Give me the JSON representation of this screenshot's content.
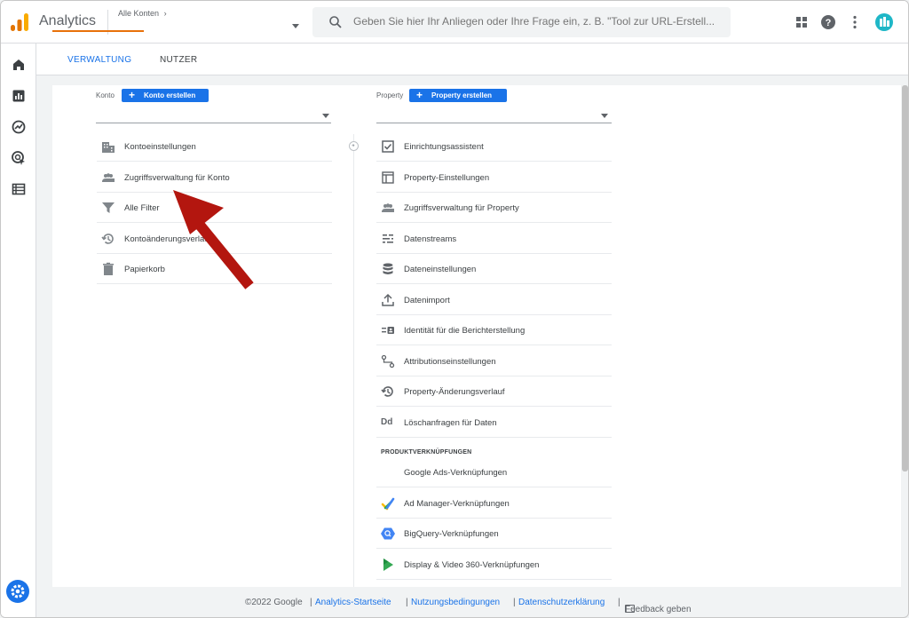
{
  "header": {
    "app_title": "Analytics",
    "account_breadcrumb": "Alle Konten",
    "search_placeholder": "Geben Sie hier Ihr Anliegen oder Ihre Frage ein, z. B. \"Tool zur URL-Erstell...",
    "icons": [
      "apps-icon",
      "help-icon",
      "more-vert-icon",
      "account-avatar-icon"
    ]
  },
  "sidebar": {
    "items": [
      {
        "name": "home-icon"
      },
      {
        "name": "reports-icon"
      },
      {
        "name": "explore-icon"
      },
      {
        "name": "advertising-icon"
      },
      {
        "name": "configure-icon"
      }
    ],
    "settings_icon": "gear-icon"
  },
  "tabs": [
    {
      "label": "VERWALTUNG",
      "active": true
    },
    {
      "label": "NUTZER",
      "active": false
    }
  ],
  "account_column": {
    "label": "Konto",
    "create_label": "Konto erstellen",
    "items": [
      {
        "label": "Kontoeinstellungen",
        "icon": "building-icon"
      },
      {
        "label": "Zugriffsverwaltung für Konto",
        "icon": "people-icon"
      },
      {
        "label": "Alle Filter",
        "icon": "filter-icon"
      },
      {
        "label": "Kontoänderungsverlauf",
        "icon": "history-icon"
      },
      {
        "label": "Papierkorb",
        "icon": "trash-icon"
      }
    ]
  },
  "property_column": {
    "label": "Property",
    "create_label": "Property erstellen",
    "items": [
      {
        "label": "Einrichtungsassistent",
        "icon": "checkbox-icon"
      },
      {
        "label": "Property-Einstellungen",
        "icon": "layout-icon"
      },
      {
        "label": "Zugriffsverwaltung für Property",
        "icon": "people-icon"
      },
      {
        "label": "Datenstreams",
        "icon": "streams-icon"
      },
      {
        "label": "Dateneinstellungen",
        "icon": "database-icon"
      },
      {
        "label": "Datenimport",
        "icon": "upload-icon"
      },
      {
        "label": "Identität für die Berichterstellung",
        "icon": "identity-icon"
      },
      {
        "label": "Attributionseinstellungen",
        "icon": "attribution-icon"
      },
      {
        "label": "Property-Änderungsverlauf",
        "icon": "history-icon"
      },
      {
        "label": "Löschanfragen für Daten",
        "icon": "dd-icon",
        "icon_text": "Dd"
      }
    ],
    "links_section_title": "PRODUKTVERKNÜPFUNGEN",
    "links": [
      {
        "label": "Google Ads-Verknüpfungen",
        "icon": "google-ads-icon"
      },
      {
        "label": "Ad Manager-Verknüpfungen",
        "icon": "ad-manager-icon"
      },
      {
        "label": "BigQuery-Verknüpfungen",
        "icon": "bigquery-icon"
      },
      {
        "label": "Display & Video 360-Verknüpfungen",
        "icon": "dv360-icon"
      }
    ]
  },
  "footer": {
    "copyright": "©2022 Google",
    "sep": "|",
    "links": [
      "Analytics-Startseite",
      "Nutzungsbedingungen",
      "Datenschutzerklärung"
    ],
    "feedback": "Feedback geben"
  },
  "colors": {
    "accent": "#1a73e8",
    "tab_underline": "#e8710a",
    "annotation_arrow": "#b3160f"
  }
}
